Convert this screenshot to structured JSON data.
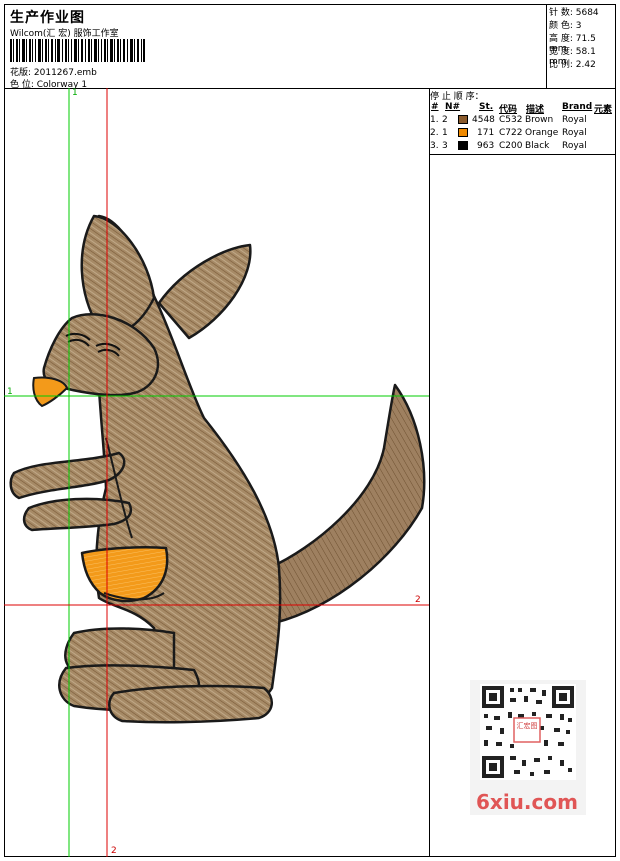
{
  "header": {
    "title": "生产作业图",
    "company": "Wilcom(汇 宏) 服饰工作室",
    "design_label": "花版: 2011267.emb",
    "colorway_label": "色 位:  Colorway 1"
  },
  "stats": [
    "针 数: 5684",
    "颜 色: 3",
    "高 度: 71.5 mm",
    "宽 度: 58.1 mm",
    "比 例: 2.42"
  ],
  "stop_sequence": {
    "title": "停 止 顺 序：",
    "columns": [
      "#",
      "N#",
      "St.",
      "代码",
      "描述",
      "Brand",
      "元素"
    ],
    "rows": [
      {
        "index": "1.",
        "needle": "2",
        "stitches": "4548",
        "code": "C532",
        "desc": "Brown",
        "brand": "Royal",
        "color": "#8a5a2b"
      },
      {
        "index": "2.",
        "needle": "1",
        "stitches": "171",
        "code": "C722",
        "desc": "Orange",
        "brand": "Royal",
        "color": "#f08a00"
      },
      {
        "index": "3.",
        "needle": "3",
        "stitches": "963",
        "code": "C200",
        "desc": "Black",
        "brand": "Royal",
        "color": "#000000"
      }
    ]
  },
  "guides": {
    "v1": "1",
    "v2": "2",
    "h1": "1",
    "h2": "2"
  },
  "colors": {
    "kangaroo_fill": "#a58864",
    "kangaroo_stroke": "#1a1a1a",
    "pouch": "#f39a1a",
    "guide_green": "#00cc00",
    "guide_red": "#dd0000"
  },
  "watermark": {
    "site": "6xiu.com",
    "stamp": "汇宏图"
  }
}
